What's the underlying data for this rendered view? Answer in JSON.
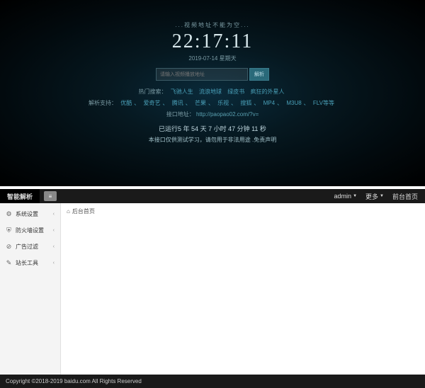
{
  "top": {
    "title": "...视频地址不能为空...",
    "clock": "22:17:11",
    "date": "2019-07-14 星期天",
    "search_placeholder": "请输入视频播放地址",
    "search_btn": "解析",
    "hot_label": "热门搜索：",
    "hot_links": [
      "飞驰人生",
      "流浪地球",
      "绿皮书",
      "疯狂的外星人"
    ],
    "support_label": "解析支持：",
    "support_links": [
      "优酷",
      "爱奇艺",
      "腾讯",
      "芒果",
      "乐视",
      "搜狐",
      "MP4",
      "M3U8",
      "FLV等等"
    ],
    "api_label": "接口地址：",
    "api_url": "http://paopao02.com/?v=",
    "runtime": "已运行5 年 54 天 7 小时 47 分钟 11 秒",
    "disclaimer": "本接口仅供测试学习，请勿用于非法用途 .免责声明"
  },
  "admin": {
    "brand": "智能解析",
    "toggle_icon": "≡",
    "header_right": [
      {
        "label": "admin",
        "caret": true
      },
      {
        "label": "更多",
        "caret": true
      },
      {
        "label": "前台首页",
        "caret": false
      }
    ],
    "sidebar": [
      {
        "icon": "⚙",
        "label": "系统设置"
      },
      {
        "icon": "⛨",
        "label": "防火墙设置"
      },
      {
        "icon": "⊘",
        "label": "广告过滤"
      },
      {
        "icon": "✎",
        "label": "站长工具"
      }
    ],
    "breadcrumb_icon": "⌂",
    "breadcrumb": "后台首页"
  },
  "footer": "Copyright ©2018-2019 baidu.com All Rights Reserved"
}
